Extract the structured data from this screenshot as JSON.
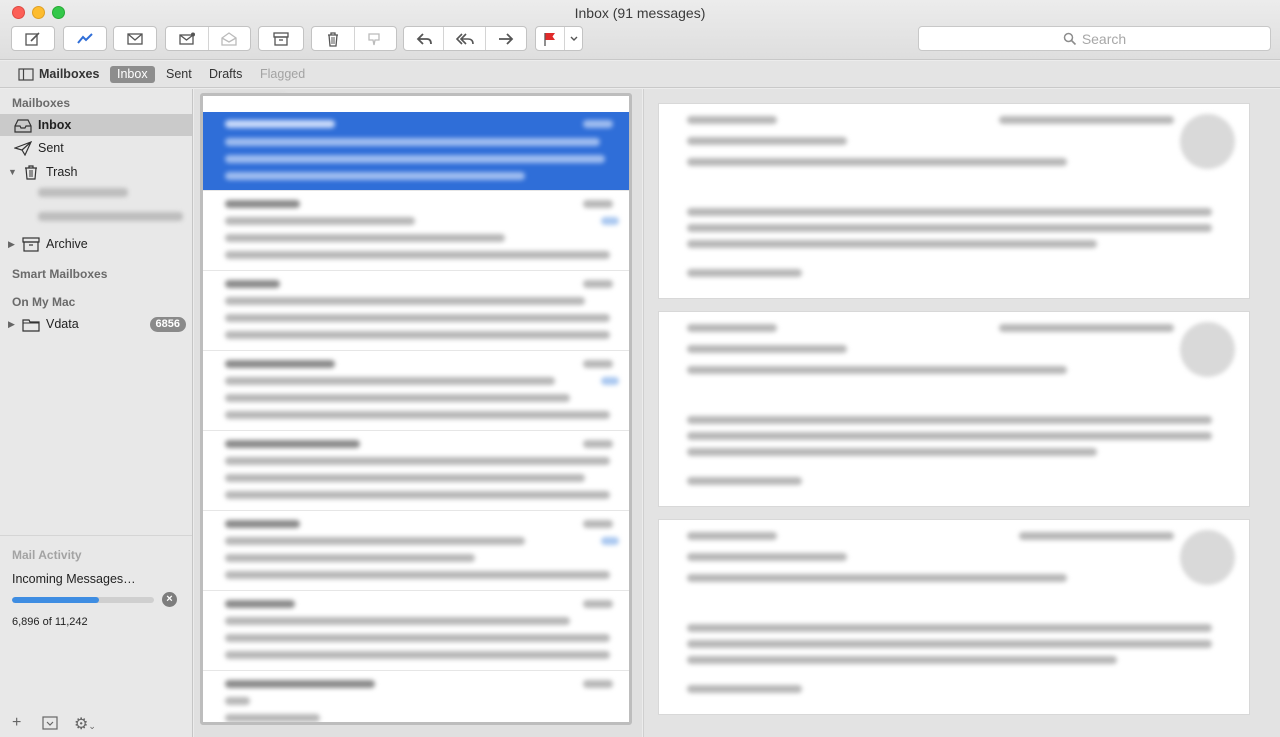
{
  "window": {
    "title": "Inbox (91 messages)"
  },
  "toolbar": {
    "icons": [
      "compose-icon",
      "activity-icon",
      "get-mail-icon",
      "new-mail-icon",
      "junk-icon",
      "archive-icon",
      "trash-icon",
      "junk-thumb-icon",
      "reply-icon",
      "reply-all-icon",
      "forward-icon",
      "flag-icon",
      "chevron-down-icon"
    ],
    "flag_color": "#e02a2a",
    "search_placeholder": "Search"
  },
  "favorites": {
    "mailboxes_label": "Mailboxes",
    "items": [
      {
        "label": "Inbox",
        "selected": true
      },
      {
        "label": "Sent"
      },
      {
        "label": "Drafts"
      },
      {
        "label": "Flagged",
        "disabled": true
      }
    ]
  },
  "sidebar": {
    "mailboxes_header": "Mailboxes",
    "items": [
      {
        "label": "Inbox",
        "icon": "inbox-tray-icon",
        "selected": true
      },
      {
        "label": "Sent",
        "icon": "paper-plane-icon"
      },
      {
        "label": "Trash",
        "icon": "trash-icon",
        "expanded": true
      },
      {
        "label": "Archive",
        "icon": "archive-box-icon"
      }
    ],
    "smart_header": "Smart Mailboxes",
    "mac_header": "On My Mac",
    "mac_items": [
      {
        "label": "Vdata",
        "icon": "folder-icon",
        "badge": "6856"
      }
    ],
    "activity": {
      "title": "Mail Activity",
      "message": "Incoming Messages…",
      "progress": 0.6135,
      "count": "6,896 of 11,242"
    },
    "bottom": {
      "add": "+",
      "gear": "⚙"
    }
  },
  "colors": {
    "selection_blue": "#2f6ed8",
    "progress_blue": "#3e8de2"
  }
}
